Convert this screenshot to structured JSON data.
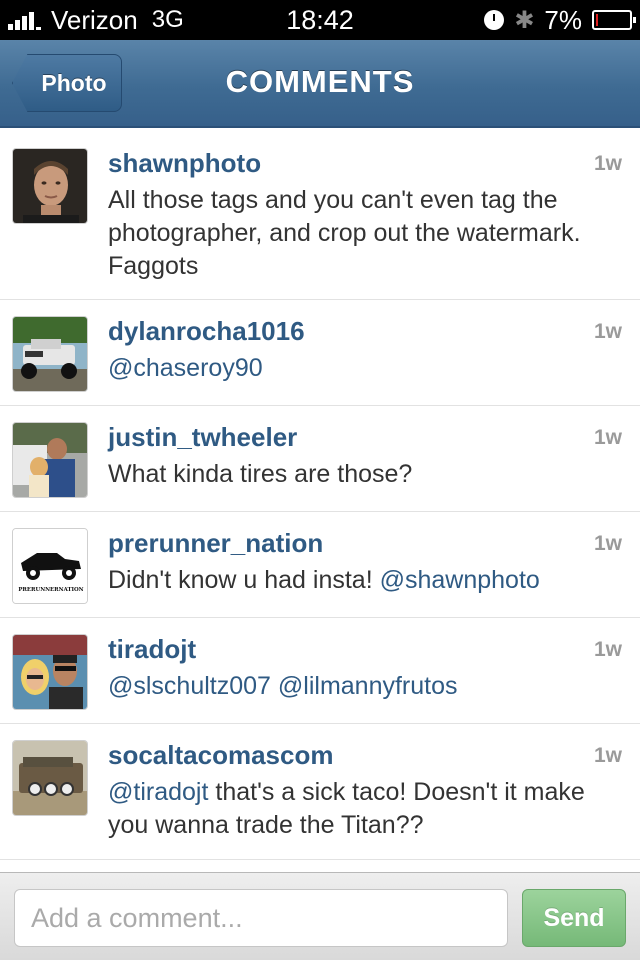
{
  "status_bar": {
    "carrier": "Verizon",
    "network": "3G",
    "time": "18:42",
    "battery_percent": "7%",
    "battery_level": 0.07,
    "icons": [
      "signal-icon",
      "clock-icon",
      "bluetooth-icon",
      "battery-icon"
    ]
  },
  "nav": {
    "back_label": "Photo",
    "title": "COMMENTS"
  },
  "comments": [
    {
      "username": "shawnphoto",
      "time": "1w",
      "parts": [
        {
          "text": "All those tags and you can't even tag the photographer, and crop out the watermark. Faggots",
          "mention": false
        }
      ]
    },
    {
      "username": "dylanrocha1016",
      "time": "1w",
      "parts": [
        {
          "text": "@chaseroy90",
          "mention": false
        }
      ]
    },
    {
      "username": "justin_twheeler",
      "time": "1w",
      "parts": [
        {
          "text": "What kinda tires are those?",
          "mention": false
        }
      ]
    },
    {
      "username": "prerunner_nation",
      "time": "1w",
      "parts": [
        {
          "text": "Didn't know u had insta! ",
          "mention": false
        },
        {
          "text": "@shawnphoto",
          "mention": true
        }
      ]
    },
    {
      "username": "tiradojt",
      "time": "1w",
      "parts": [
        {
          "text": "@slschultz007 @lilmannyfrutos",
          "mention": true
        }
      ]
    },
    {
      "username": "socaltacomascom",
      "time": "1w",
      "parts": [
        {
          "text": "@tiradojt",
          "mention": true
        },
        {
          "text": " that's a sick taco! Doesn't it make you wanna trade the Titan??",
          "mention": false
        }
      ]
    }
  ],
  "avatars": {
    "prerunner_logo_text": "PRERUNNERNATION"
  },
  "bottom_bar": {
    "input_placeholder": "Add a comment...",
    "send_label": "Send"
  },
  "colors": {
    "nav_blue": "#3f6b93",
    "username_blue": "#2f5a83",
    "send_green": "#76b978",
    "battery_red": "#e02020"
  }
}
